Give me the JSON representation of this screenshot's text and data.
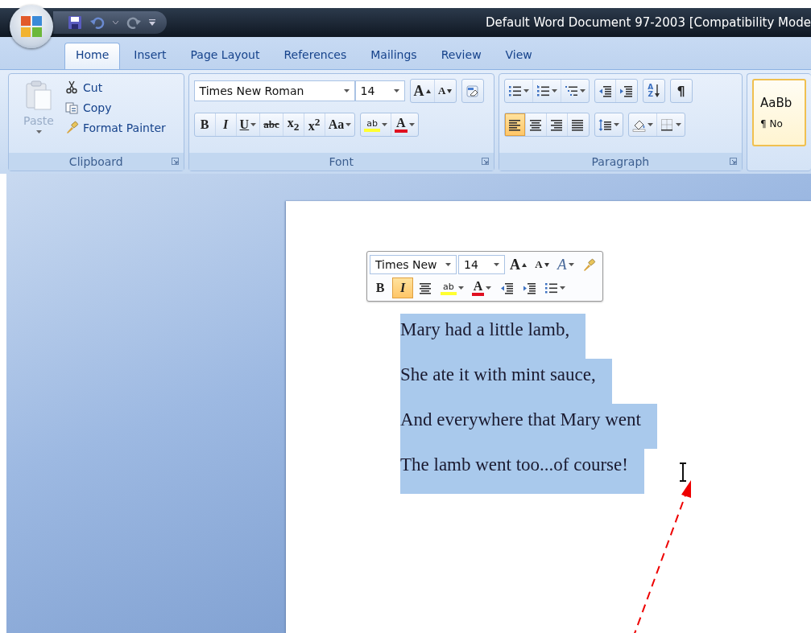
{
  "window": {
    "title": "Default Word Document 97-2003 [Compatibility Mode"
  },
  "tabs": [
    {
      "label": "Home",
      "selected": true
    },
    {
      "label": "Insert",
      "selected": false
    },
    {
      "label": "Page Layout",
      "selected": false
    },
    {
      "label": "References",
      "selected": false
    },
    {
      "label": "Mailings",
      "selected": false
    },
    {
      "label": "Review",
      "selected": false
    },
    {
      "label": "View",
      "selected": false
    }
  ],
  "clipboard": {
    "label": "Clipboard",
    "paste": {
      "label": "Paste",
      "disabled": true
    },
    "items": [
      {
        "kind": "cut",
        "label": "Cut"
      },
      {
        "kind": "copy",
        "label": "Copy"
      },
      {
        "kind": "painter",
        "label": "Format Painter"
      }
    ]
  },
  "font": {
    "label": "Font",
    "font_name": "Times New Roman",
    "font_size": "14",
    "row1": [
      {
        "kind": "grow",
        "label": "A",
        "selected": false
      },
      {
        "kind": "shrink",
        "label": "A",
        "selected": false
      },
      {
        "kind": "clear",
        "selected": false
      }
    ],
    "row2": [
      {
        "kind": "bold",
        "label": "B",
        "selected": false
      },
      {
        "kind": "italic",
        "label": "I",
        "selected": false
      },
      {
        "kind": "underline",
        "label": "U",
        "dropdown": true,
        "selected": false
      },
      {
        "kind": "strike",
        "label": "abc",
        "selected": false
      },
      {
        "kind": "sub",
        "label": "x$_{2}$",
        "selected": false
      },
      {
        "kind": "super",
        "label": "x$^{2}$",
        "selected": false
      },
      {
        "kind": "case",
        "label": "Aa",
        "dropdown": true,
        "selected": false
      },
      {
        "kind": "highlight",
        "label": "ab",
        "dropdown": true,
        "selected": false
      },
      {
        "kind": "color",
        "label": "A",
        "dropdown": true,
        "selected": false
      }
    ]
  },
  "paragraph": {
    "label": "Paragraph",
    "row1": [
      {
        "kind": "bullets",
        "dropdown": true,
        "selected": false
      },
      {
        "kind": "numbering",
        "dropdown": true,
        "selected": false
      },
      {
        "kind": "multilevel",
        "dropdown": true,
        "selected": false
      },
      {
        "kind": "outdent",
        "selected": false
      },
      {
        "kind": "indent",
        "selected": false
      },
      {
        "kind": "sort",
        "label": "AZ",
        "selected": false
      },
      {
        "kind": "pilcrow",
        "label": "¶",
        "selected": false
      }
    ],
    "row2": [
      {
        "kind": "align-left",
        "selected": true
      },
      {
        "kind": "align-center",
        "selected": false
      },
      {
        "kind": "align-right",
        "selected": false
      },
      {
        "kind": "justify",
        "selected": false
      },
      {
        "kind": "spacing",
        "dropdown": true,
        "selected": false
      },
      {
        "kind": "shading",
        "dropdown": true,
        "selected": false
      },
      {
        "kind": "borders",
        "dropdown": true,
        "selected": false
      }
    ]
  },
  "styles": {
    "sample": "AaBb",
    "name": "¶ No",
    "selected": true
  },
  "mini_toolbar": {
    "font_name": "Times New",
    "font_size": "14",
    "row1": [
      {
        "kind": "grow",
        "label": "A",
        "selected": false
      },
      {
        "kind": "shrink",
        "label": "A",
        "selected": false
      },
      {
        "kind": "styles",
        "label": "A",
        "dropdown": true,
        "selected": false
      },
      {
        "kind": "painter-btn",
        "selected": false
      }
    ],
    "row2": [
      {
        "kind": "bold",
        "label": "B",
        "selected": false
      },
      {
        "kind": "italic",
        "label": "I",
        "selected": true
      },
      {
        "kind": "align-center",
        "selected": false
      },
      {
        "kind": "highlight",
        "label": "ab",
        "dropdown": true,
        "selected": false
      },
      {
        "kind": "color",
        "label": "A",
        "dropdown": true,
        "selected": false
      },
      {
        "kind": "outdent",
        "selected": false
      },
      {
        "kind": "indent",
        "selected": false
      },
      {
        "kind": "bullets",
        "dropdown": true,
        "selected": false
      }
    ]
  },
  "document": {
    "lines": [
      {
        "text": "Mary had a little lamb,",
        "selected": true
      },
      {
        "text": "She ate it with mint sauce,",
        "selected": true
      },
      {
        "text": "And everywhere that Mary went",
        "selected": true
      },
      {
        "text": "The lamb went too...of course!",
        "selected": true
      }
    ]
  }
}
